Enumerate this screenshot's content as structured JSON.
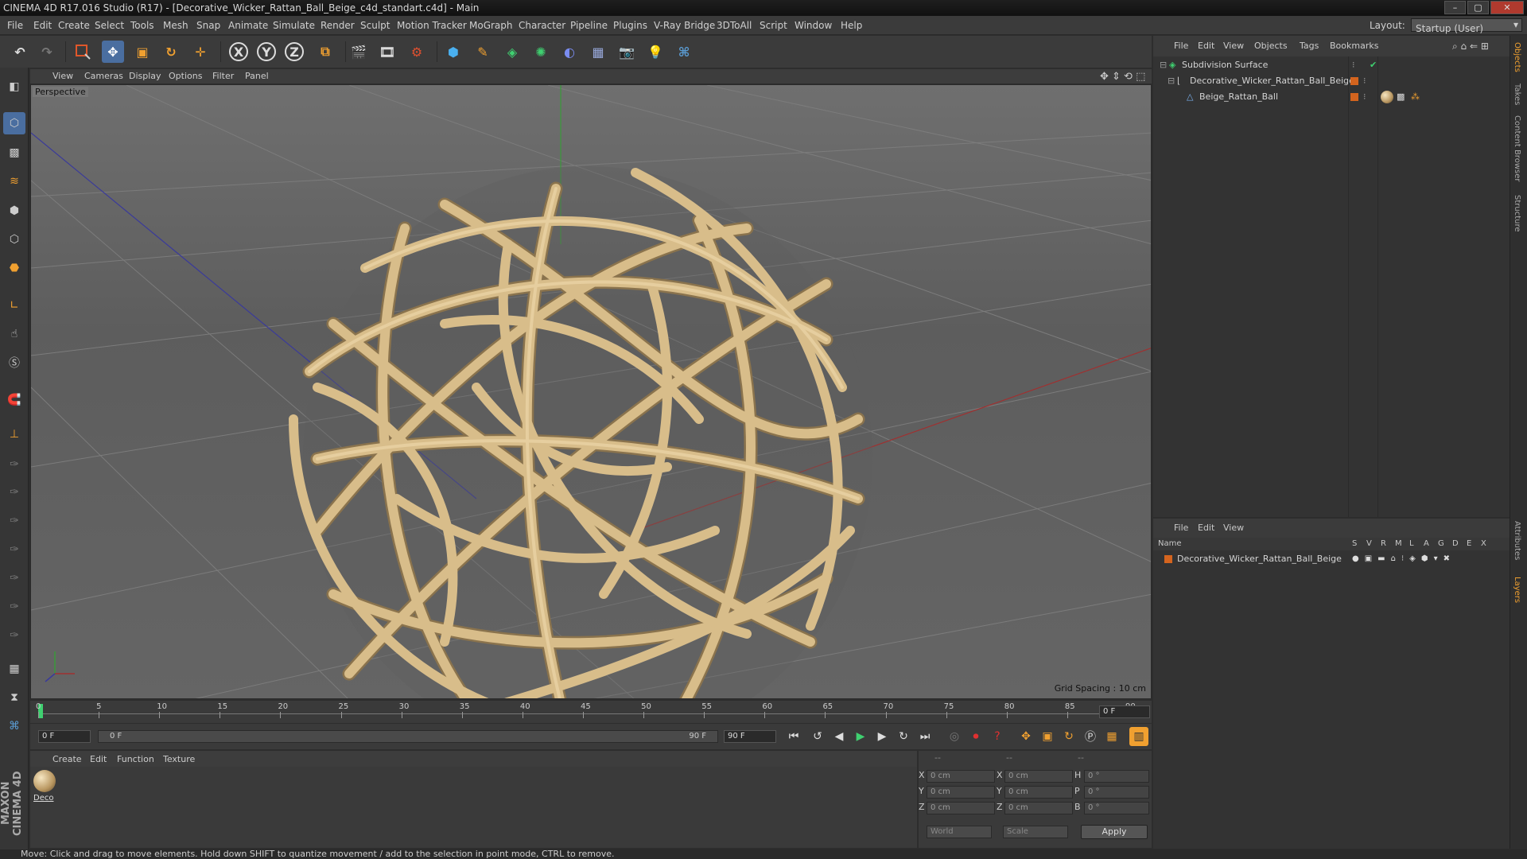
{
  "window": {
    "title": "CINEMA 4D R17.016 Studio (R17) - [Decorative_Wicker_Rattan_Ball_Beige_c4d_standart.c4d] - Main",
    "controls": [
      "–",
      "▢",
      "✕"
    ]
  },
  "menubar": {
    "items": [
      "File",
      "Edit",
      "Create",
      "Select",
      "Tools",
      "Mesh",
      "Snap",
      "Animate",
      "Simulate",
      "Render",
      "Sculpt",
      "Motion Tracker",
      "MoGraph",
      "Character",
      "Pipeline",
      "Plugins",
      "V-Ray Bridge",
      "3DToAll",
      "Script",
      "Window",
      "Help"
    ],
    "layout_label": "Layout:",
    "layout_value": "Startup (User)"
  },
  "toolbar": {
    "icons": [
      "undo-icon",
      "redo-icon",
      "live-selection-icon",
      "move-icon",
      "scale-icon",
      "rotate-icon",
      "transform-icon",
      "x-axis-icon",
      "y-axis-icon",
      "z-axis-icon",
      "coordinate-system-icon",
      "render-view-icon",
      "render-picture-viewer-icon",
      "edit-render-settings-icon",
      "cube-icon",
      "spline-pen-icon",
      "subdivision-surface-icon",
      "cloner-icon",
      "deformer-icon",
      "floor-icon",
      "camera-icon",
      "light-icon",
      "python-icon"
    ],
    "axis_labels": [
      "X",
      "Y",
      "Z"
    ]
  },
  "viewport": {
    "menu": [
      "View",
      "Cameras",
      "Display",
      "Options",
      "Filter",
      "Panel"
    ],
    "label": "Perspective",
    "grid_spacing": "Grid Spacing : 10 cm"
  },
  "timeline": {
    "ticks": [
      "0",
      "5",
      "10",
      "15",
      "20",
      "25",
      "30",
      "35",
      "40",
      "45",
      "50",
      "55",
      "60",
      "65",
      "70",
      "75",
      "80",
      "85",
      "90"
    ],
    "current_frame": "0 F"
  },
  "playbar": {
    "start_field": "0 F",
    "range_start": "0 F",
    "range_end": "90 F",
    "end_field": "90 F"
  },
  "materials": {
    "menu": [
      "Create",
      "Edit",
      "Function",
      "Texture"
    ],
    "items": [
      {
        "name": "Deco"
      }
    ]
  },
  "coordinates": {
    "headers": [
      "--",
      "--",
      "--"
    ],
    "rows": [
      {
        "pos_label": "X",
        "pos": "0 cm",
        "size_label": "X",
        "size": "0 cm",
        "rot_label": "H",
        "rot": "0 °"
      },
      {
        "pos_label": "Y",
        "pos": "0 cm",
        "size_label": "Y",
        "size": "0 cm",
        "rot_label": "P",
        "rot": "0 °"
      },
      {
        "pos_label": "Z",
        "pos": "0 cm",
        "size_label": "Z",
        "size": "0 cm",
        "rot_label": "B",
        "rot": "0 °"
      }
    ],
    "space": "World",
    "mode": "Scale",
    "apply": "Apply"
  },
  "objects": {
    "menu": [
      "File",
      "Edit",
      "View",
      "Objects",
      "Tags",
      "Bookmarks"
    ],
    "tree": [
      {
        "name": "Subdivision Surface",
        "depth": 0
      },
      {
        "name": "Decorative_Wicker_Rattan_Ball_Beige",
        "depth": 1
      },
      {
        "name": "Beige_Rattan_Ball",
        "depth": 2
      }
    ]
  },
  "layers": {
    "menu": [
      "File",
      "Edit",
      "View"
    ],
    "name_header": "Name",
    "columns": [
      "S",
      "V",
      "R",
      "M",
      "L",
      "A",
      "G",
      "D",
      "E",
      "X"
    ],
    "rows": [
      {
        "name": "Decorative_Wicker_Rattan_Ball_Beige",
        "color": "#d4641e"
      }
    ]
  },
  "right_tabs": [
    "Objects",
    "Takes",
    "Content Browser",
    "Structure",
    "Attributes",
    "Layers"
  ],
  "branding": "MAXON CINEMA 4D",
  "status": "Move: Click and drag to move elements. Hold down SHIFT to quantize movement / add to the selection in point mode, CTRL to remove.",
  "colors": {
    "accent": "#f0a030",
    "layer": "#d4641e",
    "rattan": "#d8bd8a"
  }
}
